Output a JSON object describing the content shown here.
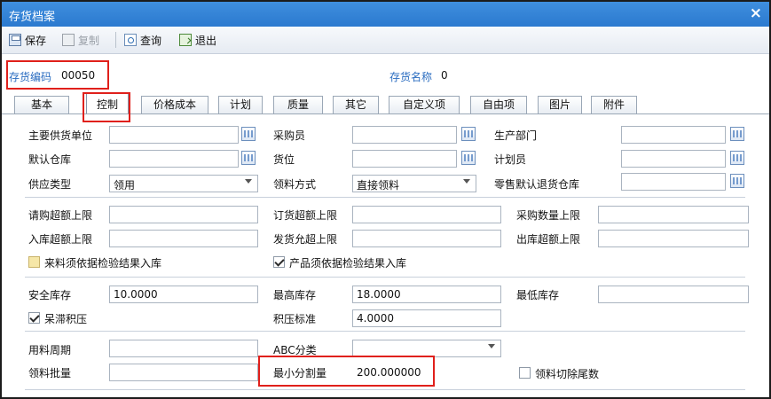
{
  "window": {
    "title": "存货档案",
    "close_glyph": "×"
  },
  "toolbar": {
    "save": "保存",
    "copy": "复制",
    "query": "查询",
    "exit": "退出"
  },
  "header": {
    "code_label": "存货编码",
    "code_value": "00050",
    "name_label": "存货名称",
    "name_value": "0"
  },
  "tabs": [
    "基本",
    "控制",
    "价格成本",
    "计划",
    "质量",
    "其它",
    "自定义项",
    "自由项",
    "图片",
    "附件"
  ],
  "active_tab": "控制",
  "section1": {
    "main_supplier": "主要供货单位",
    "buyer": "采购员",
    "production_dept": "生产部门",
    "default_warehouse": "默认仓库",
    "location": "货位",
    "planner": "计划员",
    "supply_type": "供应类型",
    "supply_type_value": "领用",
    "issue_method": "领料方式",
    "issue_method_value": "直接领料",
    "retail_return_warehouse": "零售默认退货仓库"
  },
  "section2": {
    "purchase_req_over_limit": "请购超额上限",
    "order_over_limit": "订货超额上限",
    "purchase_qty_limit": "采购数量上限",
    "inbound_over_limit": "入库超额上限",
    "shipment_over_limit": "发货允超上限",
    "outbound_over_limit": "出库超额上限",
    "incoming_inspection": "来料须依据检验结果入库",
    "product_inspection": "产品须依据检验结果入库"
  },
  "section3": {
    "safety_stock": "安全库存",
    "safety_stock_value": "10.0000",
    "max_stock": "最高库存",
    "max_stock_value": "18.0000",
    "min_stock": "最低库存",
    "slow_moving": "呆滞积压",
    "overstock_standard": "积压标准",
    "overstock_standard_value": "4.0000"
  },
  "section4": {
    "usage_cycle": "用料周期",
    "abc_class": "ABC分类",
    "issue_batch": "领料批量",
    "min_split_qty": "最小分割量",
    "min_split_qty_value": "200.000000",
    "issue_cut_tail": "领料切除尾数"
  }
}
